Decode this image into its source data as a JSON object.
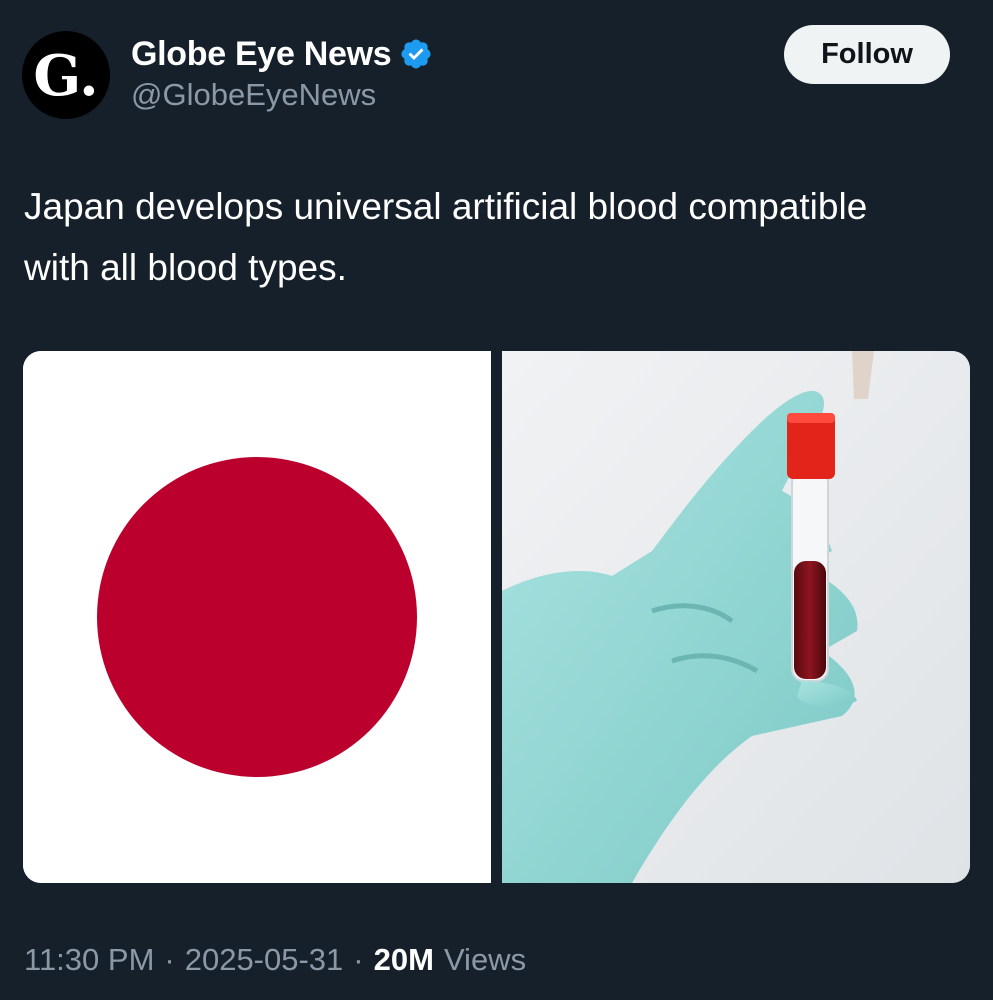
{
  "account": {
    "avatar_letter": "G.",
    "display_name": "Globe Eye News",
    "handle": "@GlobeEyeNews",
    "verified": true
  },
  "follow_label": "Follow",
  "tweet_text": "Japan develops universal artificial blood compatible with all blood types.",
  "media": {
    "left_image": "japan-flag",
    "right_image": "gloved-hand-holding-blood-tube"
  },
  "footer": {
    "time": "11:30 PM",
    "separator": "·",
    "date": "2025-05-31",
    "views_count": "20M",
    "views_label": "Views"
  },
  "colors": {
    "background": "#15202b",
    "secondary_text": "#8b98a5",
    "verified_blue": "#1d9bf0",
    "flag_red": "#bc002d"
  }
}
